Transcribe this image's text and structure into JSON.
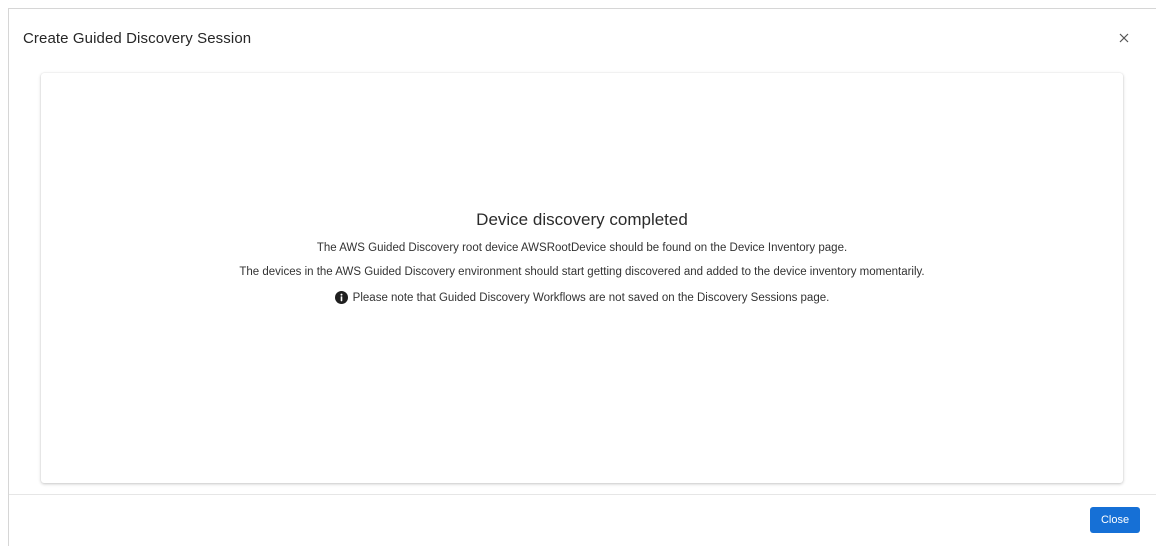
{
  "dialog": {
    "title": "Create Guided Discovery Session",
    "close_icon": "close-icon"
  },
  "message": {
    "title": "Device discovery completed",
    "line1": "The AWS Guided Discovery root device AWSRootDevice should be found on the Device Inventory page.",
    "line2": "The devices in the AWS Guided Discovery environment should start getting discovered and added to the device inventory momentarily.",
    "note_icon": "info-icon",
    "note": "Please note that Guided Discovery Workflows are not saved on the Discovery Sessions page."
  },
  "footer": {
    "close_label": "Close"
  },
  "colors": {
    "primary_button": "#1670d6",
    "info_icon": "#1f1f1f"
  }
}
